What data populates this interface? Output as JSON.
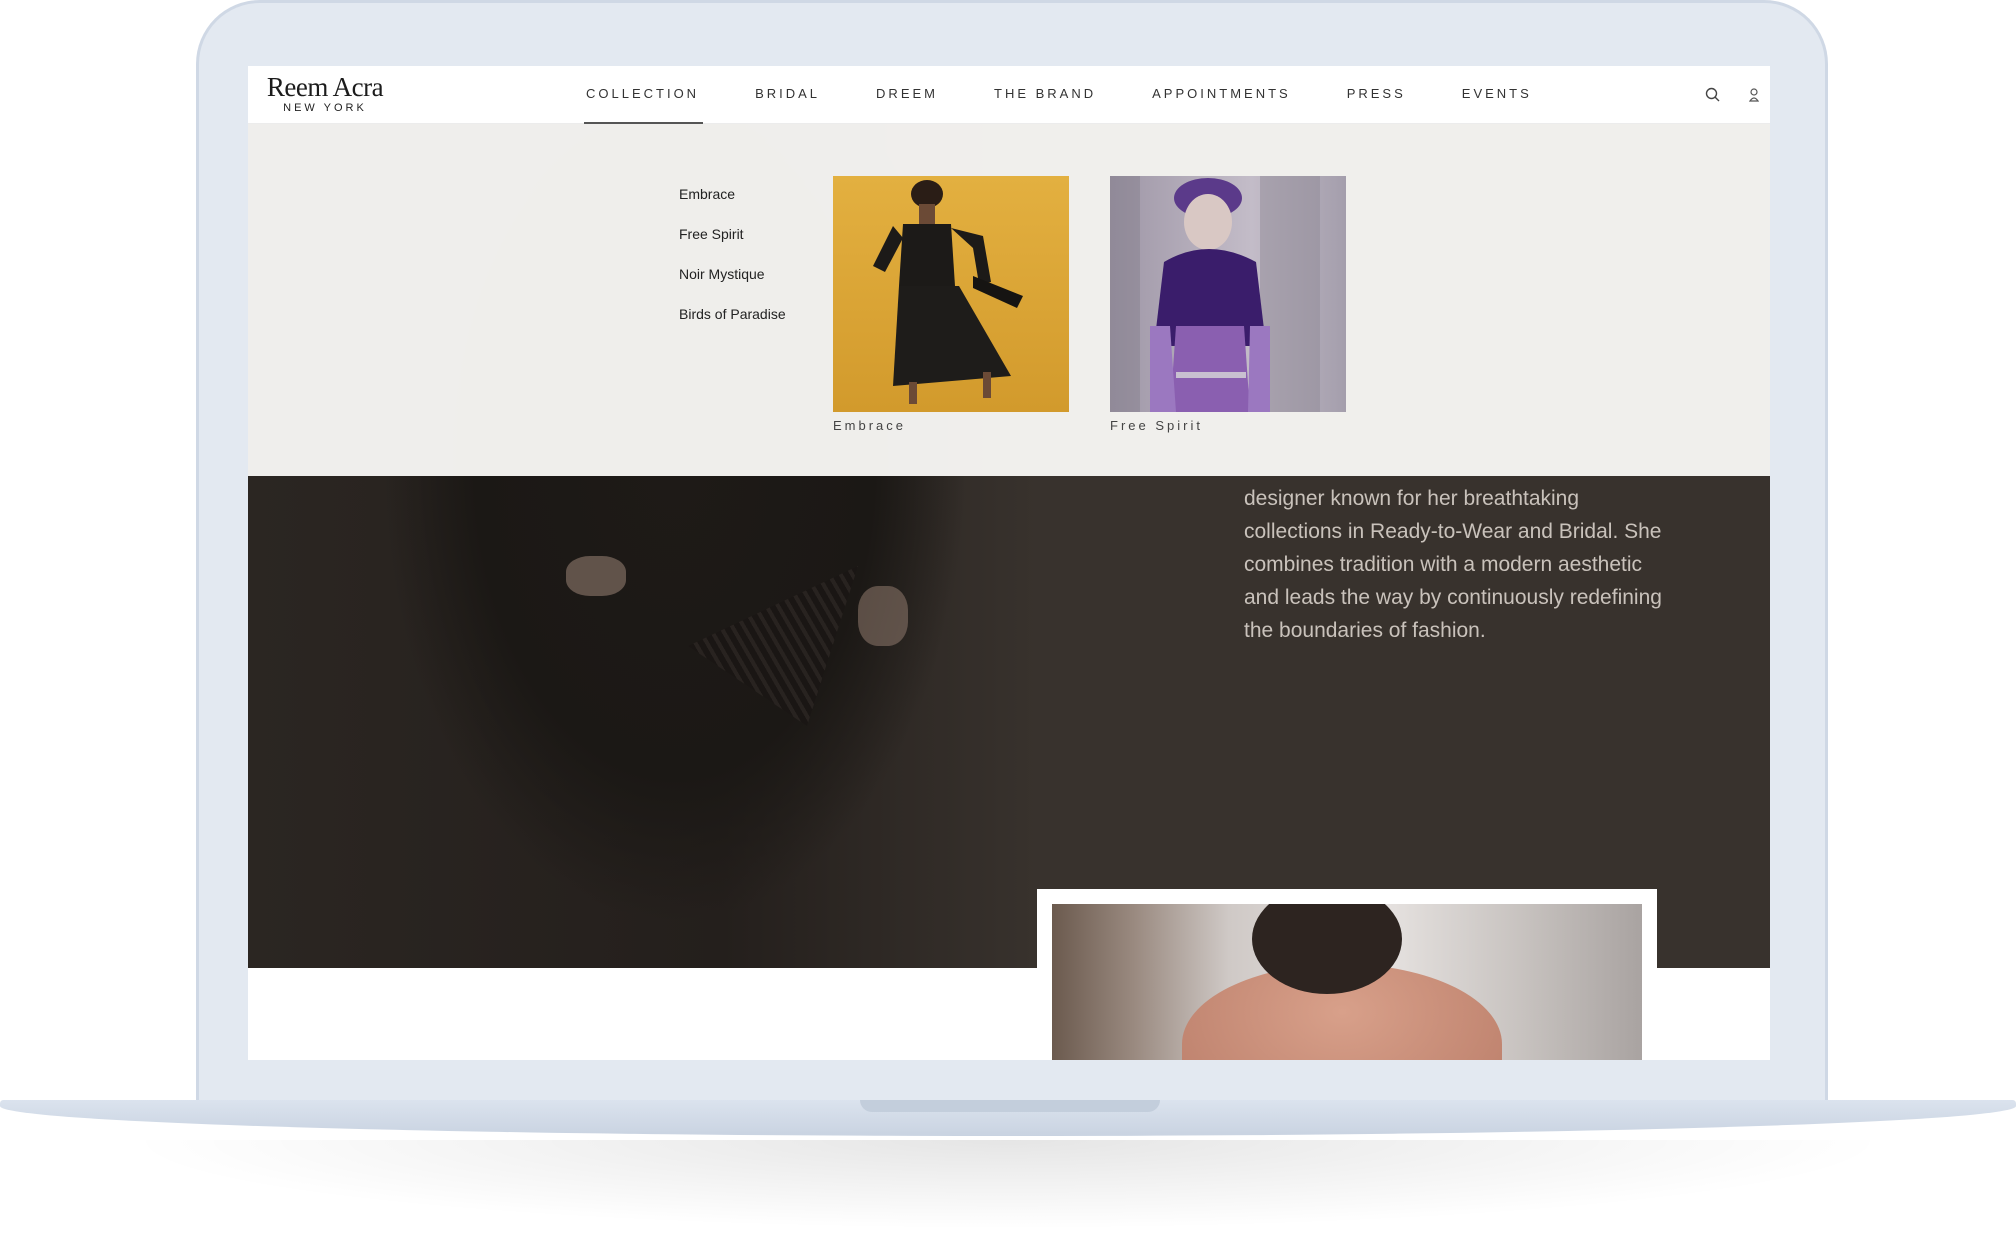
{
  "brand": {
    "name": "Reem Acra",
    "city": "NEW YORK"
  },
  "nav": {
    "items": [
      {
        "label": "COLLECTION"
      },
      {
        "label": "BRIDAL"
      },
      {
        "label": "DREEM"
      },
      {
        "label": "THE BRAND"
      },
      {
        "label": "APPOINTMENTS"
      },
      {
        "label": "PRESS"
      },
      {
        "label": "EVENTS"
      }
    ],
    "active": "COLLECTION",
    "icons": [
      "search-icon",
      "user-icon"
    ]
  },
  "mega_menu": {
    "links": [
      {
        "label": "Embrace"
      },
      {
        "label": "Free Spirit"
      },
      {
        "label": "Noir Mystique"
      },
      {
        "label": "Birds of Paradise"
      }
    ],
    "cards": [
      {
        "caption": "Embrace"
      },
      {
        "caption": "Free Spirit"
      }
    ]
  },
  "hero": {
    "text": "designer known for her breathtaking collections in Ready-to-Wear and Bridal. She combines tradition with a modern aesthetic and leads the way by continuously redefining the boundaries of fashion."
  },
  "colors": {
    "hero_background": "#38322d",
    "menu_background": "#f8f7f5",
    "hero_text": "#c9c2bb",
    "laptop_frame": "#e3e9f1"
  }
}
